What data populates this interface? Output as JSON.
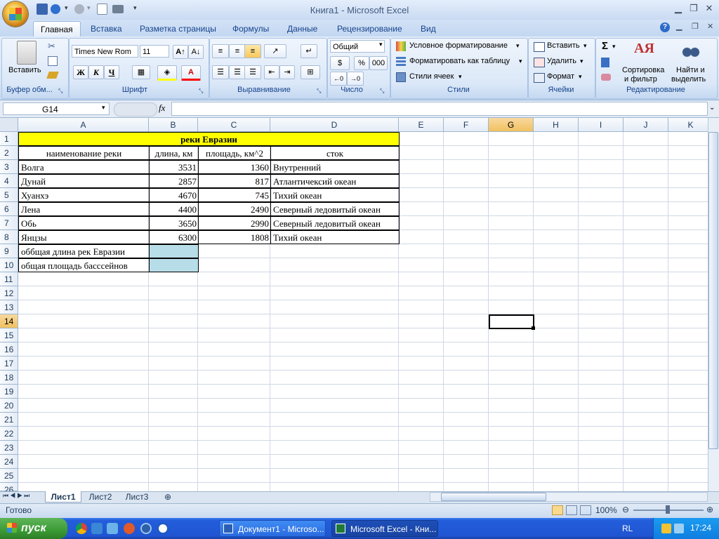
{
  "window": {
    "title": "Книга1 - Microsoft Excel"
  },
  "ribbon": {
    "tabs": [
      "Главная",
      "Вставка",
      "Разметка страницы",
      "Формулы",
      "Данные",
      "Рецензирование",
      "Вид"
    ],
    "clipboard": {
      "paste": "Вставить",
      "group": "Буфер обм..."
    },
    "font": {
      "name": "Times New Rom",
      "size": "11",
      "bold": "Ж",
      "italic": "К",
      "underline": "Ч",
      "group": "Шрифт"
    },
    "alignment": {
      "group": "Выравнивание"
    },
    "number": {
      "format": "Общий",
      "percent": "%",
      "thousands": "000",
      "group": "Число"
    },
    "styles": {
      "conditional": "Условное форматирование",
      "table": "Форматировать как таблицу",
      "cell": "Стили ячеек",
      "group": "Стили"
    },
    "cells": {
      "insert": "Вставить",
      "delete": "Удалить",
      "format": "Формат",
      "group": "Ячейки"
    },
    "editing": {
      "sort1": "Сортировка",
      "sort2": "и фильтр",
      "find1": "Найти и",
      "find2": "выделить",
      "group": "Редактирование",
      "sum": "Σ"
    }
  },
  "formula_bar": {
    "name_box": "G14",
    "fx": "fx",
    "value": ""
  },
  "columns": [
    "A",
    "B",
    "C",
    "D",
    "E",
    "F",
    "G",
    "H",
    "I",
    "J",
    "K"
  ],
  "rows": [
    "1",
    "2",
    "3",
    "4",
    "5",
    "6",
    "7",
    "8",
    "9",
    "10",
    "11",
    "12",
    "13",
    "14",
    "15",
    "16",
    "17",
    "18",
    "19",
    "20",
    "21",
    "22",
    "23",
    "24",
    "25",
    "26"
  ],
  "sheet": {
    "title": "реки Евразии",
    "headers": [
      "наименование реки",
      "длина, км",
      "площадь, км^2",
      "сток"
    ],
    "data": [
      [
        "Волга",
        "3531",
        "1360",
        "Внутренний"
      ],
      [
        "Дунай",
        "2857",
        "817",
        "Атлантичексий океан"
      ],
      [
        "Хуанхэ",
        "4670",
        "745",
        "Тихий океан"
      ],
      [
        "Лена",
        "4400",
        "2490",
        "Северный ледовитый океан"
      ],
      [
        "Обь",
        "3650",
        "2990",
        "Северный ледовитый океан"
      ],
      [
        "Янцзы",
        "6300",
        "1808",
        "Тихий океан"
      ]
    ],
    "summary": [
      "оббщая длина рек Евразии",
      "общая площадь басссейнов"
    ]
  },
  "sheet_tabs": [
    "Лист1",
    "Лист2",
    "Лист3"
  ],
  "status": {
    "ready": "Готово",
    "zoom": "100%"
  },
  "taskbar": {
    "start": "пуск",
    "items": [
      "Документ1 - Microso...",
      "Microsoft Excel - Кни..."
    ],
    "lang": "RL",
    "time": "17:24"
  },
  "colors": {
    "title_fill": "#ffff00",
    "summary_fill": "#b7dde8",
    "selected_header": "#f5c96d"
  }
}
